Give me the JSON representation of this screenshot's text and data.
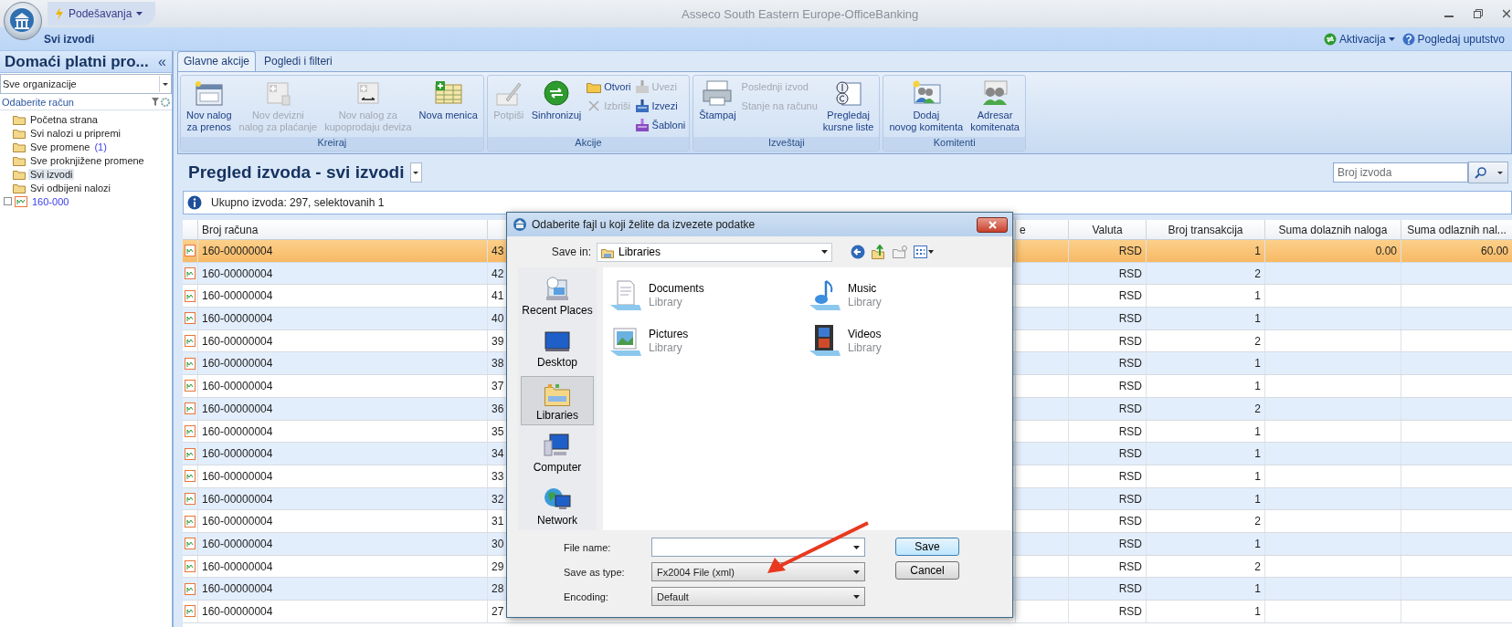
{
  "app": {
    "menu": "Podešavanja",
    "title": "Asseco South Eastern Europe-OfficeBanking",
    "breadcrumb": "Svi izvodi",
    "actions": [
      {
        "label": "Aktivacija",
        "kind": "dropdown"
      },
      {
        "label": "Pogledaj uputstvo",
        "kind": "help"
      }
    ]
  },
  "sidebar": {
    "title": "Domaći platni pro...",
    "collapse": "«",
    "organization": "Sve organizacije",
    "account_label": "Odaberite račun",
    "items": [
      {
        "label": "Početna strana",
        "kind": "folder",
        "selected": false
      },
      {
        "label": "Svi nalozi u pripremi",
        "kind": "folder",
        "selected": false
      },
      {
        "label": "Sve promene",
        "count": "(1)",
        "kind": "folder",
        "selected": false
      },
      {
        "label": "Sve proknjižene promene",
        "kind": "folder",
        "selected": false
      },
      {
        "label": "Svi izvodi",
        "kind": "folder",
        "selected": true
      },
      {
        "label": "Svi odbijeni nalozi",
        "kind": "folder",
        "selected": false
      },
      {
        "label": "160-000",
        "kind": "account",
        "expanded": false,
        "selected": false
      }
    ]
  },
  "ribbon": {
    "tabs": [
      {
        "label": "Glavne akcije",
        "selected": true
      },
      {
        "label": "Pogledi i filteri",
        "selected": false
      }
    ],
    "groups": [
      {
        "label": "Kreiraj",
        "items": [
          {
            "kind": "large",
            "label": "Nov nalog\nza prenos",
            "disabled": false
          },
          {
            "kind": "large",
            "label": "Nov devizni\nnalog za plaćanje",
            "disabled": true
          },
          {
            "kind": "large",
            "label": "Nov nalog za\nkupoprodaju deviza",
            "disabled": true
          },
          {
            "kind": "large",
            "label": "Nova menica",
            "disabled": false
          }
        ]
      },
      {
        "label": "Akcije",
        "items": [
          {
            "kind": "large",
            "label": "Potpiši",
            "disabled": true
          },
          {
            "kind": "large",
            "label": "Sinhronizuj",
            "disabled": false
          },
          {
            "kind": "stack",
            "buttons": [
              {
                "label": "Otvori",
                "disabled": false
              },
              {
                "label": "Izbriši",
                "disabled": true
              }
            ]
          },
          {
            "kind": "stack",
            "buttons": [
              {
                "label": "Uvezi",
                "disabled": true
              },
              {
                "label": "Izvezi",
                "disabled": false
              },
              {
                "label": "Šabloni",
                "disabled": false
              }
            ]
          }
        ]
      },
      {
        "label": "Izveštaji",
        "items": [
          {
            "kind": "large",
            "label": "Štampaj",
            "disabled": false
          },
          {
            "kind": "stack",
            "buttons": [
              {
                "label": "Poslednji izvod",
                "disabled": true
              },
              {
                "label": "Stanje na računu",
                "disabled": true
              }
            ]
          },
          {
            "kind": "large",
            "label": "Pregledaj\nkursne liste",
            "disabled": false
          }
        ]
      },
      {
        "label": "Komitenti",
        "items": [
          {
            "kind": "large",
            "label": "Dodaj\nnovog komitenta",
            "disabled": false
          },
          {
            "kind": "large",
            "label": "Adresar\nkomitenata",
            "disabled": false
          }
        ]
      }
    ]
  },
  "view": {
    "title": "Pregled izvoda - svi izvodi",
    "search": {
      "placeholder": "Broj izvoda"
    },
    "info": "Ukupno izvoda: 297, selektovanih 1"
  },
  "table": {
    "columns": [
      "Broj računa",
      "",
      "e",
      "Valuta",
      "Broj transakcija",
      "Suma dolaznih naloga",
      "Suma odlaznih nal..."
    ],
    "rows": [
      {
        "selected": true,
        "account": "160-00000004",
        "column_2": "43",
        "currency": "RSD",
        "transactions": "1",
        "incoming": "0.00",
        "outgoing": "60.00"
      },
      {
        "selected": false,
        "account": "160-00000004",
        "column_2": "42",
        "currency": "RSD",
        "transactions": "2"
      },
      {
        "selected": false,
        "account": "160-00000004",
        "column_2": "41",
        "currency": "RSD",
        "transactions": "1"
      },
      {
        "selected": false,
        "account": "160-00000004",
        "column_2": "40",
        "currency": "RSD",
        "transactions": "1"
      },
      {
        "selected": false,
        "account": "160-00000004",
        "column_2": "39",
        "currency": "RSD",
        "transactions": "2"
      },
      {
        "selected": false,
        "account": "160-00000004",
        "column_2": "38",
        "currency": "RSD",
        "transactions": "1"
      },
      {
        "selected": false,
        "account": "160-00000004",
        "column_2": "37",
        "currency": "RSD",
        "transactions": "1"
      },
      {
        "selected": false,
        "account": "160-00000004",
        "column_2": "36",
        "currency": "RSD",
        "transactions": "2"
      },
      {
        "selected": false,
        "account": "160-00000004",
        "column_2": "35",
        "currency": "RSD",
        "transactions": "1"
      },
      {
        "selected": false,
        "account": "160-00000004",
        "column_2": "34",
        "currency": "RSD",
        "transactions": "1"
      },
      {
        "selected": false,
        "account": "160-00000004",
        "column_2": "33",
        "currency": "RSD",
        "transactions": "1"
      },
      {
        "selected": false,
        "account": "160-00000004",
        "column_2": "32",
        "currency": "RSD",
        "transactions": "1"
      },
      {
        "selected": false,
        "account": "160-00000004",
        "column_2": "31",
        "currency": "RSD",
        "transactions": "2"
      },
      {
        "selected": false,
        "account": "160-00000004",
        "column_2": "30",
        "currency": "RSD",
        "transactions": "1"
      },
      {
        "selected": false,
        "account": "160-00000004",
        "column_2": "29",
        "currency": "RSD",
        "transactions": "2"
      },
      {
        "selected": false,
        "account": "160-00000004",
        "column_2": "28",
        "currency": "RSD",
        "transactions": "1"
      },
      {
        "selected": false,
        "account": "160-00000004",
        "column_2": "27",
        "currency": "RSD",
        "transactions": "1"
      }
    ]
  },
  "dialog": {
    "title": "Odaberite fajl u koji želite da izvezete podatke",
    "save_in_label": "Save in:",
    "save_in": "Libraries",
    "places": [
      {
        "label": "Recent Places",
        "selected": false
      },
      {
        "label": "Desktop",
        "selected": false
      },
      {
        "label": "Libraries",
        "selected": true
      },
      {
        "label": "Computer",
        "selected": false
      },
      {
        "label": "Network",
        "selected": false
      }
    ],
    "files": [
      {
        "name": "Documents",
        "type": "Library"
      },
      {
        "name": "Music",
        "type": "Library"
      },
      {
        "name": "Pictures",
        "type": "Library"
      },
      {
        "name": "Videos",
        "type": "Library"
      }
    ],
    "fields": [
      {
        "label": "File name:",
        "kind": "input"
      },
      {
        "label": "Save as type:",
        "kind": "select",
        "value": "Fx2004 File (xml)"
      },
      {
        "label": "Encoding:",
        "kind": "select",
        "value": "Default"
      }
    ],
    "buttons": [
      {
        "label": "Save",
        "default": true
      },
      {
        "label": "Cancel",
        "default": false
      }
    ]
  }
}
